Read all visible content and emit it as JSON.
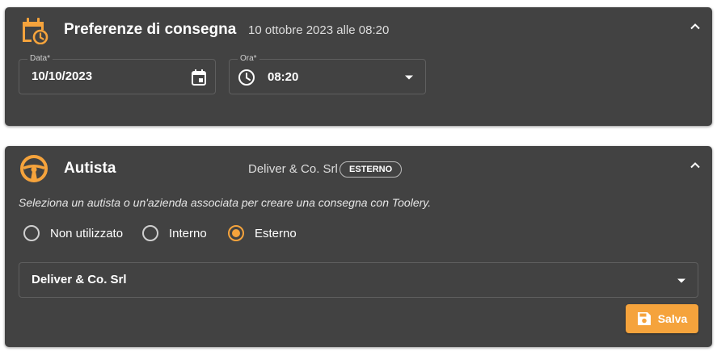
{
  "colors": {
    "accent": "#f5a33c",
    "card_bg": "#424242"
  },
  "delivery": {
    "icon": "calendar-clock-icon",
    "title": "Preferenze di consegna",
    "summary": "10 ottobre 2023 alle 08:20",
    "date": {
      "label": "Data*",
      "value": "10/10/2023",
      "icon": "calendar-icon"
    },
    "time": {
      "label": "Ora*",
      "value": "08:20",
      "icon": "clock-icon"
    }
  },
  "driver": {
    "icon": "steering-wheel-icon",
    "title": "Autista",
    "summary": "Deliver & Co. Srl",
    "badge": "ESTERNO",
    "description": "Seleziona un autista o un'azienda associata per creare una consegna con Toolery.",
    "options": [
      {
        "label": "Non utilizzato",
        "checked": false
      },
      {
        "label": "Interno",
        "checked": false
      },
      {
        "label": "Esterno",
        "checked": true
      }
    ],
    "company": "Deliver & Co. Srl",
    "save_label": "Salva"
  }
}
